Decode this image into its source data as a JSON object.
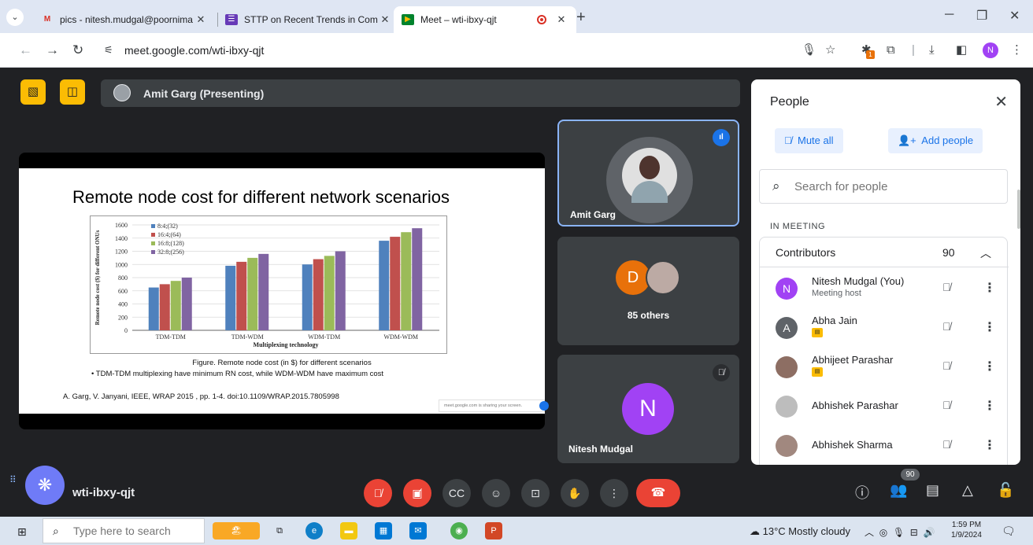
{
  "browser": {
    "tabs": [
      {
        "title": "pics - nitesh.mudgal@poornima",
        "favicon": "M",
        "favicon_color": "#d93025"
      },
      {
        "title": "STTP on Recent Trends in Comm",
        "favicon": "☰",
        "favicon_color": "#673ab7"
      },
      {
        "title": "Meet – wti-ibxy-qjt",
        "favicon": "▶",
        "favicon_color": "#00832d"
      }
    ],
    "url": "meet.google.com/wti-ibxy-qjt"
  },
  "meet": {
    "presenter_label": "Amit Garg (Presenting)",
    "meeting_code": "wti-ibxy-qjt",
    "participant_count": "90",
    "tiles": [
      {
        "name": "Amit Garg"
      },
      {
        "name": "85 others",
        "initial": "D"
      },
      {
        "name": "Nitesh Mudgal",
        "initial": "N"
      }
    ]
  },
  "slide": {
    "title": "Remote node cost for different network scenarios",
    "caption": "Figure. Remote node cost (in $) for different scenarios",
    "bullet": "•  TDM-TDM multiplexing have minimum RN cost, while WDM-WDM have maximum cost",
    "reference": "A. Garg, V. Janyani, IEEE, WRAP 2015 ,  pp. 1-4. doi:10.1109/WRAP.2015.7805998",
    "sharing_notice": "meet.google.com is sharing your screen."
  },
  "chart_data": {
    "type": "bar",
    "categories": [
      "TDM-TDM",
      "TDM-WDM",
      "WDM-TDM",
      "WDM-WDM"
    ],
    "series": [
      {
        "name": "8:4;(32)",
        "color": "#4f81bd",
        "values": [
          650,
          980,
          1000,
          1360
        ]
      },
      {
        "name": "16:4;(64)",
        "color": "#c0504d",
        "values": [
          700,
          1040,
          1080,
          1420
        ]
      },
      {
        "name": "16:8;(128)",
        "color": "#9bbb59",
        "values": [
          750,
          1100,
          1130,
          1490
        ]
      },
      {
        "name": "32:8;(256)",
        "color": "#8064a2",
        "values": [
          800,
          1160,
          1200,
          1550
        ]
      }
    ],
    "xlabel": "Multiplexing technology",
    "ylabel": "Remote node cost ($) for different ONUs",
    "ylim": [
      0,
      1600
    ],
    "yticks": [
      "0",
      "200",
      "400",
      "600",
      "800",
      "1000",
      "1200",
      "1400",
      "1600"
    ],
    "grid": true,
    "legend": "top-left"
  },
  "people": {
    "title": "People",
    "mute_all": "Mute all",
    "add_people": "Add people",
    "search_placeholder": "Search for people",
    "section": "IN MEETING",
    "group_label": "Contributors",
    "group_count": "90",
    "list": [
      {
        "name": "Nitesh Mudgal (You)",
        "sub": "Meeting host",
        "initial": "N",
        "color": "#a142f4"
      },
      {
        "name": "Abha Jain",
        "initial": "A",
        "color": "#5f6368"
      },
      {
        "name": "Abhijeet Parashar",
        "color": "#8d6e63"
      },
      {
        "name": "Abhishek Parashar",
        "color": "#bdbdbd"
      },
      {
        "name": "Abhishek Sharma",
        "color": "#a1887f"
      }
    ]
  },
  "taskbar": {
    "search_placeholder": "Type here to search",
    "weather": "13°C  Mostly cloudy",
    "time": "1:59 PM",
    "date": "1/9/2024"
  }
}
